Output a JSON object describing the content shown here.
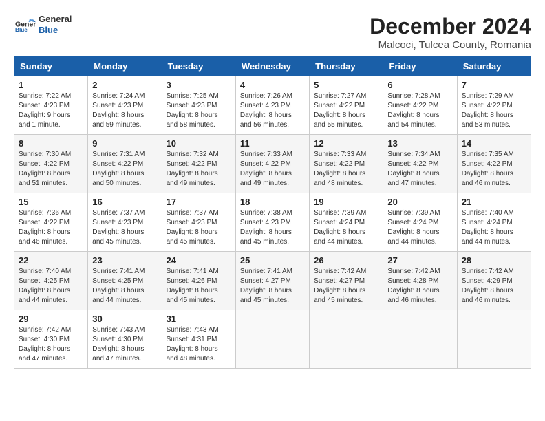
{
  "logo": {
    "general": "General",
    "blue": "Blue"
  },
  "title": "December 2024",
  "subtitle": "Malcoci, Tulcea County, Romania",
  "weekdays": [
    "Sunday",
    "Monday",
    "Tuesday",
    "Wednesday",
    "Thursday",
    "Friday",
    "Saturday"
  ],
  "weeks": [
    [
      {
        "day": "1",
        "info": "Sunrise: 7:22 AM\nSunset: 4:23 PM\nDaylight: 9 hours and 1 minute."
      },
      {
        "day": "2",
        "info": "Sunrise: 7:24 AM\nSunset: 4:23 PM\nDaylight: 8 hours and 59 minutes."
      },
      {
        "day": "3",
        "info": "Sunrise: 7:25 AM\nSunset: 4:23 PM\nDaylight: 8 hours and 58 minutes."
      },
      {
        "day": "4",
        "info": "Sunrise: 7:26 AM\nSunset: 4:23 PM\nDaylight: 8 hours and 56 minutes."
      },
      {
        "day": "5",
        "info": "Sunrise: 7:27 AM\nSunset: 4:22 PM\nDaylight: 8 hours and 55 minutes."
      },
      {
        "day": "6",
        "info": "Sunrise: 7:28 AM\nSunset: 4:22 PM\nDaylight: 8 hours and 54 minutes."
      },
      {
        "day": "7",
        "info": "Sunrise: 7:29 AM\nSunset: 4:22 PM\nDaylight: 8 hours and 53 minutes."
      }
    ],
    [
      {
        "day": "8",
        "info": "Sunrise: 7:30 AM\nSunset: 4:22 PM\nDaylight: 8 hours and 51 minutes."
      },
      {
        "day": "9",
        "info": "Sunrise: 7:31 AM\nSunset: 4:22 PM\nDaylight: 8 hours and 50 minutes."
      },
      {
        "day": "10",
        "info": "Sunrise: 7:32 AM\nSunset: 4:22 PM\nDaylight: 8 hours and 49 minutes."
      },
      {
        "day": "11",
        "info": "Sunrise: 7:33 AM\nSunset: 4:22 PM\nDaylight: 8 hours and 49 minutes."
      },
      {
        "day": "12",
        "info": "Sunrise: 7:33 AM\nSunset: 4:22 PM\nDaylight: 8 hours and 48 minutes."
      },
      {
        "day": "13",
        "info": "Sunrise: 7:34 AM\nSunset: 4:22 PM\nDaylight: 8 hours and 47 minutes."
      },
      {
        "day": "14",
        "info": "Sunrise: 7:35 AM\nSunset: 4:22 PM\nDaylight: 8 hours and 46 minutes."
      }
    ],
    [
      {
        "day": "15",
        "info": "Sunrise: 7:36 AM\nSunset: 4:22 PM\nDaylight: 8 hours and 46 minutes."
      },
      {
        "day": "16",
        "info": "Sunrise: 7:37 AM\nSunset: 4:23 PM\nDaylight: 8 hours and 45 minutes."
      },
      {
        "day": "17",
        "info": "Sunrise: 7:37 AM\nSunset: 4:23 PM\nDaylight: 8 hours and 45 minutes."
      },
      {
        "day": "18",
        "info": "Sunrise: 7:38 AM\nSunset: 4:23 PM\nDaylight: 8 hours and 45 minutes."
      },
      {
        "day": "19",
        "info": "Sunrise: 7:39 AM\nSunset: 4:24 PM\nDaylight: 8 hours and 44 minutes."
      },
      {
        "day": "20",
        "info": "Sunrise: 7:39 AM\nSunset: 4:24 PM\nDaylight: 8 hours and 44 minutes."
      },
      {
        "day": "21",
        "info": "Sunrise: 7:40 AM\nSunset: 4:24 PM\nDaylight: 8 hours and 44 minutes."
      }
    ],
    [
      {
        "day": "22",
        "info": "Sunrise: 7:40 AM\nSunset: 4:25 PM\nDaylight: 8 hours and 44 minutes."
      },
      {
        "day": "23",
        "info": "Sunrise: 7:41 AM\nSunset: 4:25 PM\nDaylight: 8 hours and 44 minutes."
      },
      {
        "day": "24",
        "info": "Sunrise: 7:41 AM\nSunset: 4:26 PM\nDaylight: 8 hours and 45 minutes."
      },
      {
        "day": "25",
        "info": "Sunrise: 7:41 AM\nSunset: 4:27 PM\nDaylight: 8 hours and 45 minutes."
      },
      {
        "day": "26",
        "info": "Sunrise: 7:42 AM\nSunset: 4:27 PM\nDaylight: 8 hours and 45 minutes."
      },
      {
        "day": "27",
        "info": "Sunrise: 7:42 AM\nSunset: 4:28 PM\nDaylight: 8 hours and 46 minutes."
      },
      {
        "day": "28",
        "info": "Sunrise: 7:42 AM\nSunset: 4:29 PM\nDaylight: 8 hours and 46 minutes."
      }
    ],
    [
      {
        "day": "29",
        "info": "Sunrise: 7:42 AM\nSunset: 4:30 PM\nDaylight: 8 hours and 47 minutes."
      },
      {
        "day": "30",
        "info": "Sunrise: 7:43 AM\nSunset: 4:30 PM\nDaylight: 8 hours and 47 minutes."
      },
      {
        "day": "31",
        "info": "Sunrise: 7:43 AM\nSunset: 4:31 PM\nDaylight: 8 hours and 48 minutes."
      },
      null,
      null,
      null,
      null
    ]
  ]
}
